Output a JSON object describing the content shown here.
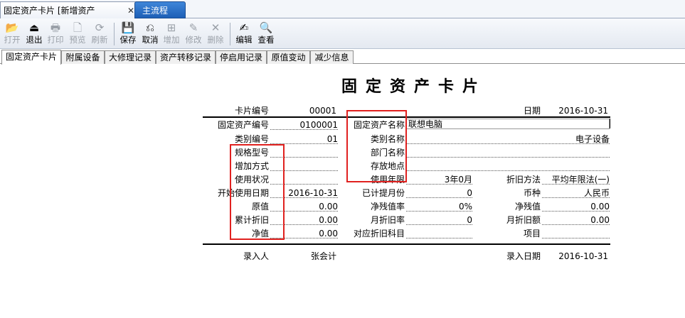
{
  "doc_tabs": [
    {
      "label": "固定资产卡片 [新增资产"
    },
    {
      "label": "主流程"
    }
  ],
  "toolbar": {
    "buttons": [
      {
        "icon": "📂",
        "label": "打开"
      },
      {
        "icon": "⏏",
        "label": "退出"
      },
      {
        "icon": "🖶",
        "label": "打印"
      },
      {
        "icon": "🗋",
        "label": "预览"
      },
      {
        "icon": "⟳",
        "label": "刷新"
      },
      {
        "icon": "💾",
        "label": "保存"
      },
      {
        "icon": "⎌",
        "label": "取消"
      },
      {
        "icon": "⊞",
        "label": "增加"
      },
      {
        "icon": "✎",
        "label": "修改"
      },
      {
        "icon": "✕",
        "label": "删除"
      },
      {
        "icon": "✍",
        "label": "编辑"
      },
      {
        "icon": "🔍",
        "label": "查看"
      }
    ]
  },
  "inner_tabs": [
    "固定资产卡片",
    "附属设备",
    "大修理记录",
    "资产转移记录",
    "停启用记录",
    "原值变动",
    "减少信息"
  ],
  "card": {
    "title": "固定资产卡片",
    "card_no_label": "卡片编号",
    "card_no": "00001",
    "date_label": "日期",
    "date": "2016-10-31",
    "asset_no_label": "固定资产编号",
    "asset_no": "0100001",
    "asset_name_label": "固定资产名称",
    "asset_name": "联想电脑",
    "category_no_label": "类别编号",
    "category_no": "01",
    "category_name_label": "类别名称",
    "category_name": "电子设备",
    "spec_label": "规格型号",
    "spec": "",
    "dept_label": "部门名称",
    "dept": "",
    "add_method_label": "增加方式",
    "add_method": "",
    "location_label": "存放地点",
    "location": "",
    "usage_label": "使用状况",
    "usage": "",
    "life_label": "使用年限",
    "life": "3年0月",
    "dep_method_label": "折旧方法",
    "dep_method": "平均年限法(一)",
    "start_date_label": "开始使用日期",
    "start_date": "2016-10-31",
    "months_label": "已计提月份",
    "months": "0",
    "currency_label": "币种",
    "currency": "人民币",
    "orig_label": "原值",
    "orig": "0.00",
    "salvage_rate_label": "净残值率",
    "salvage_rate": "0%",
    "salvage_label": "净残值",
    "salvage": "0.00",
    "acc_dep_label": "累计折旧",
    "acc_dep": "0.00",
    "monthly_rate_label": "月折旧率",
    "monthly_rate": "0",
    "monthly_dep_label": "月折旧额",
    "monthly_dep": "0.00",
    "net_label": "净值",
    "net": "0.00",
    "dep_subject_label": "对应折旧科目",
    "dep_subject": "",
    "project_label": "项目",
    "project": "",
    "entered_by_label": "录入人",
    "entered_by": "张会计",
    "entry_date_label": "录入日期",
    "entry_date": "2016-10-31"
  },
  "colors": {
    "highlight": "#e0211f",
    "active_tab": "#1d5fb6"
  }
}
